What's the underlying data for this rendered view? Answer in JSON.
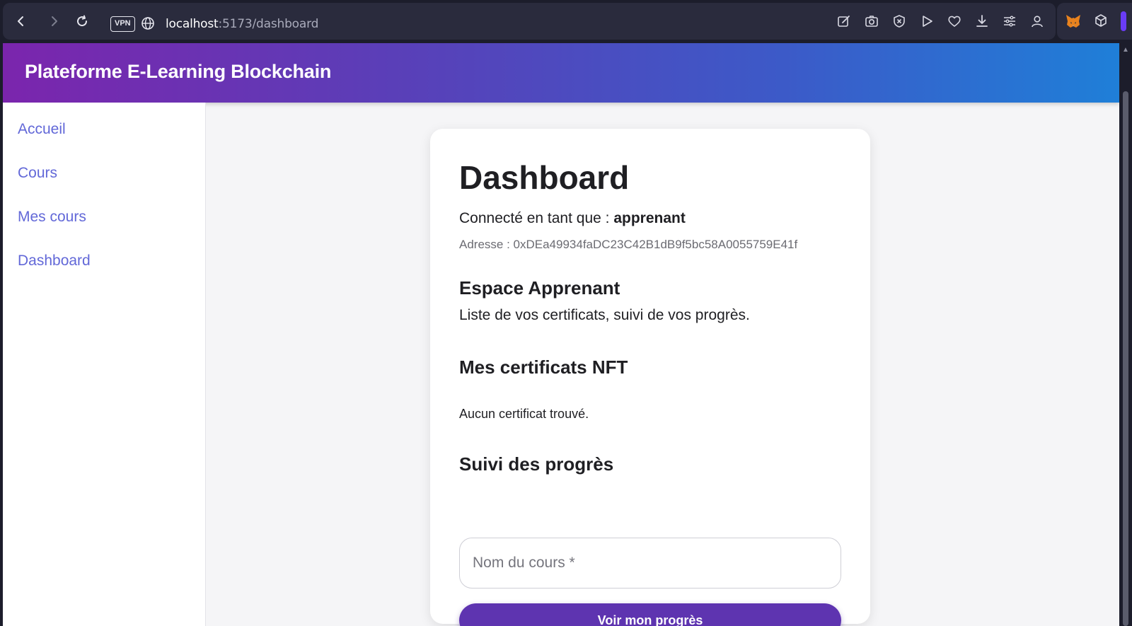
{
  "browser": {
    "vpn_label": "VPN",
    "url_host": "localhost",
    "url_path": ":5173/dashboard",
    "icons": [
      "edit-icon",
      "camera-icon",
      "shield-x-icon",
      "play-icon",
      "heart-icon",
      "download-icon",
      "settings-icon",
      "profile-icon"
    ]
  },
  "app": {
    "title": "Plateforme E-Learning Blockchain",
    "gradient_start": "#7b25ad",
    "gradient_end": "#1f7fd8",
    "accent": "#6268d8"
  },
  "sidebar": {
    "items": [
      {
        "label": "Accueil"
      },
      {
        "label": "Cours"
      },
      {
        "label": "Mes cours"
      },
      {
        "label": "Dashboard"
      }
    ]
  },
  "dashboard": {
    "title": "Dashboard",
    "connected_prefix": "Connecté en tant que : ",
    "role": "apprenant",
    "address": "Adresse : 0xDEa49934faDC23C42B1dB9f5bc58A0055759E41f",
    "space_title": "Espace Apprenant",
    "space_desc": "Liste de vos certificats, suivi de vos progrès.",
    "certs_title": "Mes certificats NFT",
    "certs_empty": "Aucun certificat trouvé.",
    "progress_title": "Suivi des progrès",
    "course_placeholder": "Nom du cours *",
    "button_label": "Voir mon progrès",
    "button_color": "#5e34b0"
  }
}
